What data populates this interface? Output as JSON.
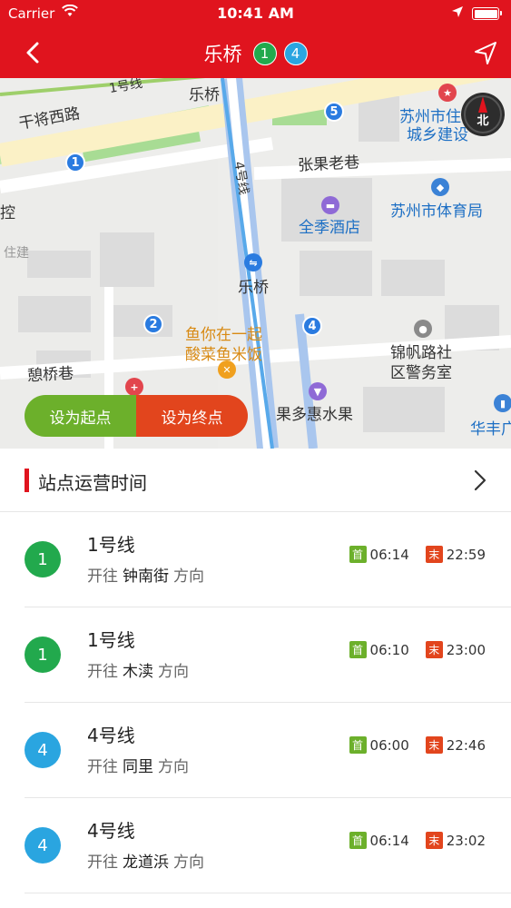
{
  "status_bar": {
    "carrier": "Carrier",
    "time": "10:41 AM"
  },
  "nav": {
    "station": "乐桥",
    "lines": [
      {
        "label": "1",
        "color": "#22a94d"
      },
      {
        "label": "4",
        "color": "#2aa5e0"
      }
    ]
  },
  "map": {
    "labels": {
      "road_ganjiang": "干将西路",
      "metro_line1": "1号线",
      "station_top": "乐桥",
      "metro_line4": "4号线",
      "zhangguo": "张果老巷",
      "quanji": "全季酒店",
      "suzhou_city_left": "苏州市住",
      "suzhou_city_left2": "城乡建设",
      "sports_bureau": "苏州市体育局",
      "station_center": "乐桥",
      "fish_restaurant_1": "鱼你在一起",
      "fish_restaurant_2": "酸菜鱼米饭",
      "jinfan_1": "锦帆路社",
      "jinfan_2": "区警务室",
      "qiqiao": "憩桥巷",
      "guoduo": "果多惠水果",
      "huafeng": "华丰广",
      "kong": "控",
      "zhujian": "住建"
    },
    "exits": [
      "1",
      "2",
      "4",
      "5"
    ],
    "compass_label": "北",
    "btn_start": "设为起点",
    "btn_end": "设为终点"
  },
  "schedule": {
    "title": "站点运营时间",
    "first_tag": "首",
    "last_tag": "末",
    "direction_prefix": "开往",
    "direction_suffix": "方向",
    "rows": [
      {
        "line_no": "1",
        "line_name": "1号线",
        "dest": "钟南街",
        "first": "06:14",
        "last": "22:59",
        "color": "#22a94d"
      },
      {
        "line_no": "1",
        "line_name": "1号线",
        "dest": "木渎",
        "first": "06:10",
        "last": "23:00",
        "color": "#22a94d"
      },
      {
        "line_no": "4",
        "line_name": "4号线",
        "dest": "同里",
        "first": "06:00",
        "last": "22:46",
        "color": "#2aa5e0"
      },
      {
        "line_no": "4",
        "line_name": "4号线",
        "dest": "龙道浜",
        "first": "06:14",
        "last": "23:02",
        "color": "#2aa5e0"
      }
    ]
  }
}
